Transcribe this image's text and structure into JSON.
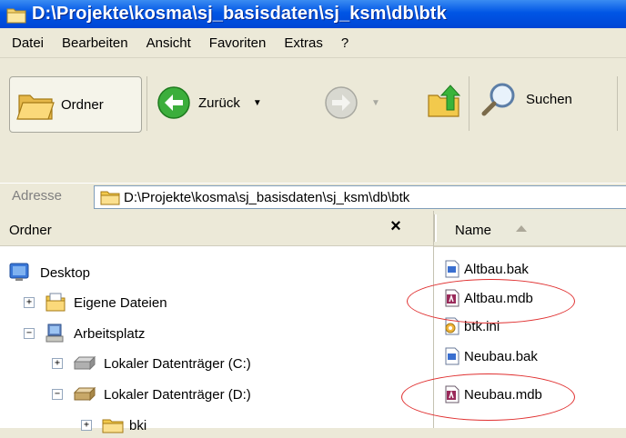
{
  "window": {
    "title": "D:\\Projekte\\kosma\\sj_basisdaten\\sj_ksm\\db\\btk"
  },
  "menu": [
    "Datei",
    "Bearbeiten",
    "Ansicht",
    "Favoriten",
    "Extras",
    "?"
  ],
  "toolbar": {
    "folders_label": "Ordner",
    "back_label": "Zurück",
    "search_label": "Suchen"
  },
  "address": {
    "label": "Adresse",
    "path": "D:\\Projekte\\kosma\\sj_basisdaten\\sj_ksm\\db\\btk"
  },
  "folder_pane": {
    "title": "Ordner",
    "close": "×",
    "tree": [
      {
        "label": "Desktop",
        "icon": "desktop-icon"
      },
      {
        "label": "Eigene Dateien",
        "icon": "my-documents-icon",
        "expander": "+"
      },
      {
        "label": "Arbeitsplatz",
        "icon": "my-computer-icon",
        "expander": "−"
      },
      {
        "label": "Lokaler Datenträger (C:)",
        "icon": "hard-drive-icon",
        "expander": "+"
      },
      {
        "label": "Lokaler Datenträger (D:)",
        "icon": "hard-drive-icon",
        "expander": "−"
      },
      {
        "label": "bki",
        "icon": "folder-icon",
        "expander": "+"
      }
    ]
  },
  "file_pane": {
    "column_name": "Name",
    "files": [
      {
        "name": "Altbau.bak",
        "icon": "bak-file-icon"
      },
      {
        "name": "Altbau.mdb",
        "icon": "access-db-icon"
      },
      {
        "name": "btk.ini",
        "icon": "ini-file-icon"
      },
      {
        "name": "Neubau.bak",
        "icon": "bak-file-icon"
      },
      {
        "name": "Neubau.mdb",
        "icon": "access-db-icon"
      }
    ]
  },
  "colors": {
    "titlebar": "#0055e5",
    "annotation": "#e03030"
  }
}
